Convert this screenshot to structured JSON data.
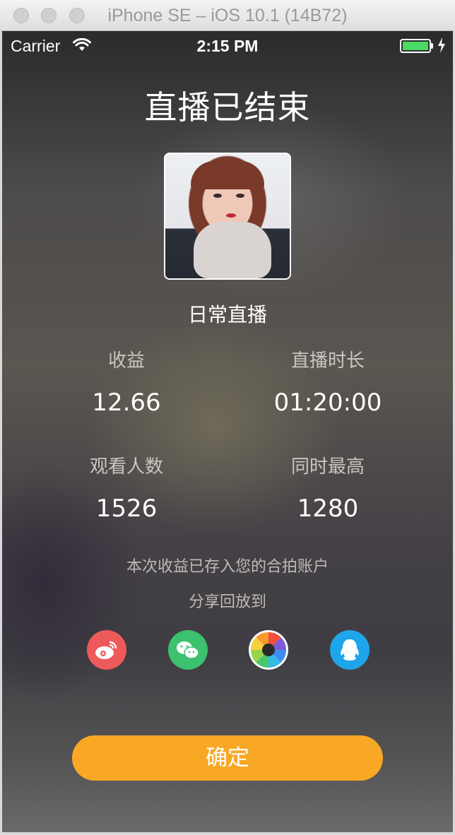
{
  "window": {
    "title": "iPhone SE – iOS 10.1 (14B72)"
  },
  "status_bar": {
    "carrier": "Carrier",
    "time": "2:15 PM",
    "battery_color": "#4cd964"
  },
  "page": {
    "title": "直播已结束",
    "live_name": "日常直播",
    "stats": {
      "income_label": "收益",
      "income_value": "12.66",
      "duration_label": "直播时长",
      "duration_value": "01:20:00",
      "viewers_label": "观看人数",
      "viewers_value": "1526",
      "peak_label": "同时最高",
      "peak_value": "1280"
    },
    "income_note": "本次收益已存入您的合拍账户",
    "share_label": "分享回放到",
    "share_targets": [
      {
        "icon": "weibo-icon",
        "color": "#ee5a5a"
      },
      {
        "icon": "wechat-icon",
        "color": "#3cc16f"
      },
      {
        "icon": "moments-icon",
        "color": "#ffffff"
      },
      {
        "icon": "qq-icon",
        "color": "#1fa5ea"
      }
    ],
    "confirm_label": "确定",
    "accent_color": "#f9a825"
  }
}
